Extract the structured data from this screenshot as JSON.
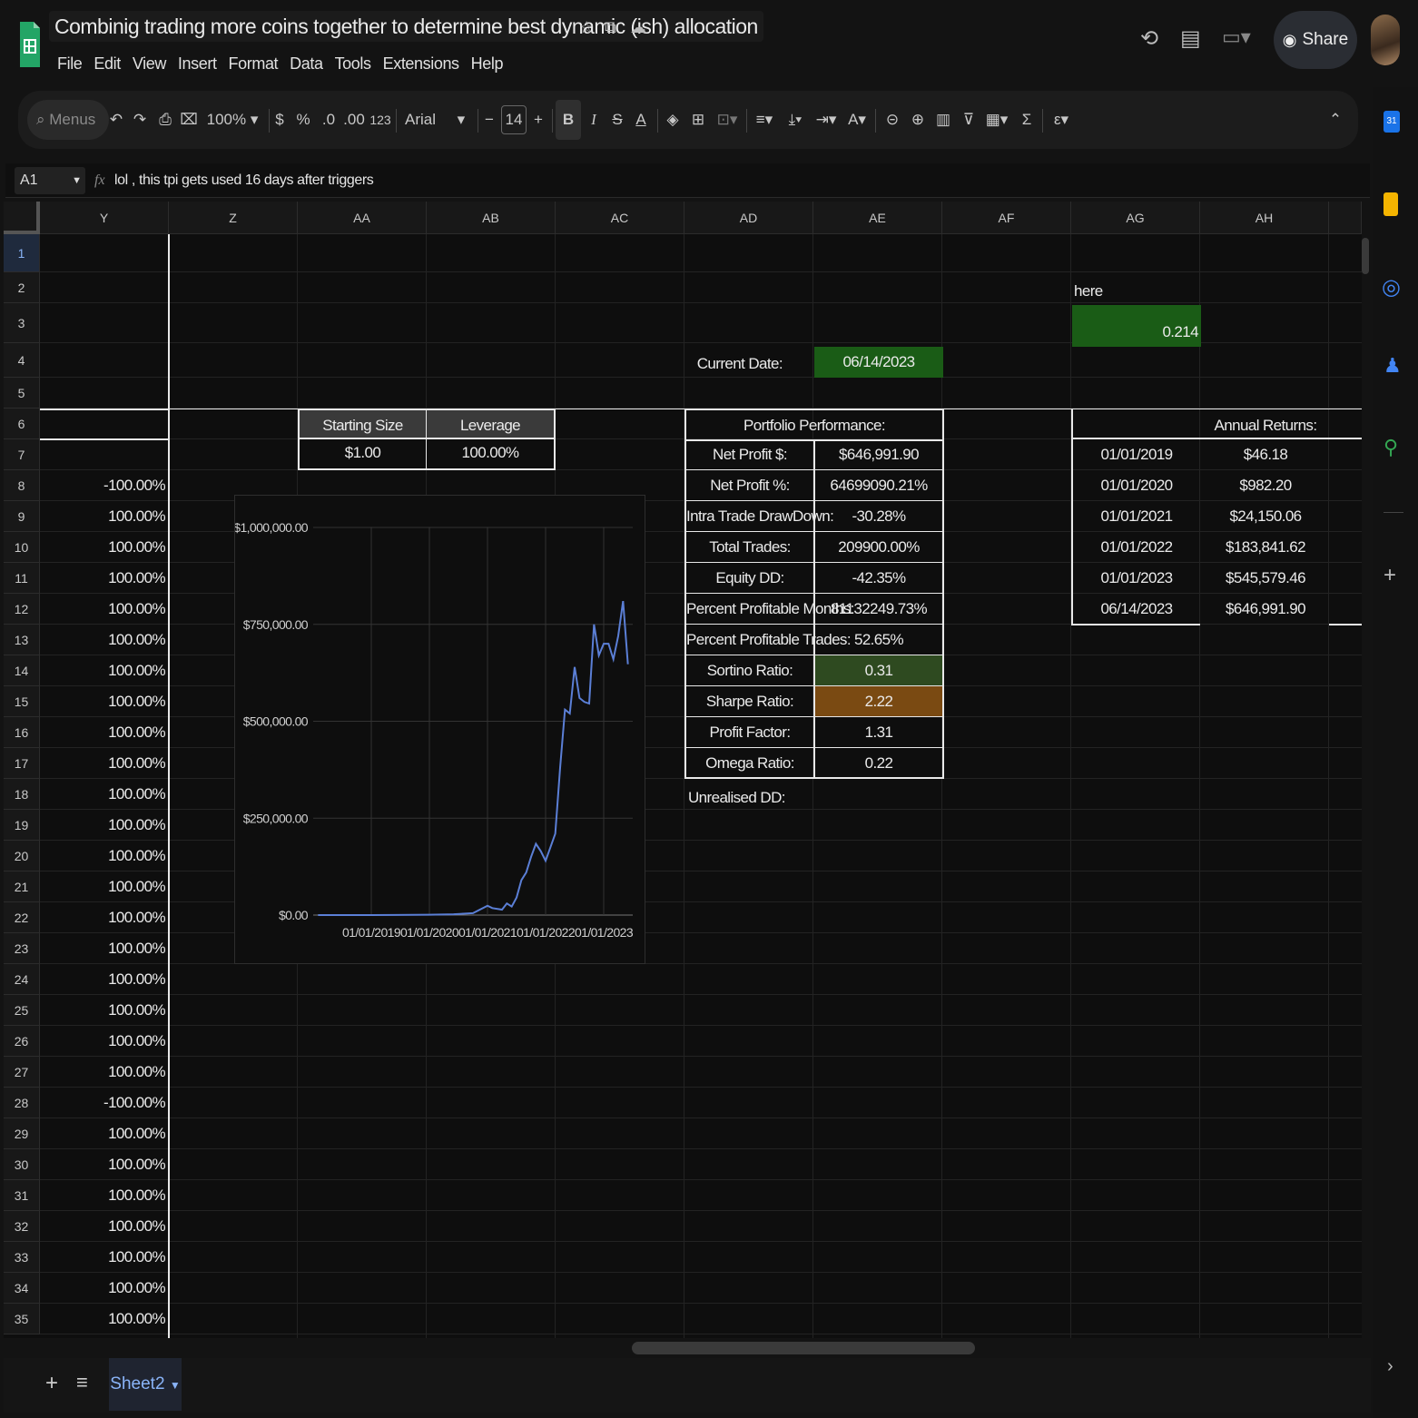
{
  "app": {
    "title": "Combinig trading more coins together to determine best dynamic (ish) allocation",
    "menus": [
      "File",
      "Edit",
      "View",
      "Insert",
      "Format",
      "Data",
      "Tools",
      "Extensions",
      "Help"
    ],
    "share_label": "Share"
  },
  "toolbar": {
    "search_placeholder": "Menus",
    "zoom": "100%",
    "currency": "$",
    "percent": "%",
    "dec_decrease": ".0",
    "dec_increase": ".00",
    "number_format": "123",
    "font": "Arial",
    "font_size": "14",
    "bold": "B",
    "italic": "I"
  },
  "formula_bar": {
    "cell_ref": "A1",
    "fx": "fx",
    "content": "lol , this tpi gets used 16 days after triggers"
  },
  "columns": [
    "Y",
    "Z",
    "AA",
    "AB",
    "AC",
    "AD",
    "AE",
    "AF",
    "AG",
    "AH"
  ],
  "rows": [
    "1",
    "2",
    "3",
    "4",
    "5",
    "6",
    "7",
    "8",
    "9",
    "10",
    "11",
    "12",
    "13",
    "14",
    "15",
    "16",
    "17",
    "18",
    "19",
    "20",
    "21",
    "22",
    "23",
    "24",
    "25",
    "26",
    "27",
    "28",
    "29",
    "30",
    "31",
    "32",
    "33",
    "34",
    "35"
  ],
  "col_y": [
    "-100.00%",
    "100.00%",
    "100.00%",
    "100.00%",
    "100.00%",
    "100.00%",
    "100.00%",
    "100.00%",
    "100.00%",
    "100.00%",
    "100.00%",
    "100.00%",
    "100.00%",
    "100.00%",
    "100.00%",
    "100.00%",
    "100.00%",
    "100.00%",
    "100.00%",
    "100.00%",
    "-100.00%",
    "100.00%",
    "100.00%",
    "100.00%",
    "100.00%",
    "100.00%",
    "100.00%",
    "100.00%"
  ],
  "here_label": "here",
  "here_value": "0.214",
  "current_date_label": "Current Date:",
  "current_date": "06/14/2023",
  "inputs": {
    "starting_size_label": "Starting Size",
    "leverage_label": "Leverage",
    "starting_size": "$1.00",
    "leverage": "100.00%"
  },
  "portfolio": {
    "header": "Portfolio Performance:",
    "rows": [
      {
        "label": "Net Profit $:",
        "value": "$646,991.90"
      },
      {
        "label": "Net Profit %:",
        "value": "64699090.21%"
      },
      {
        "label": "Intra Trade DrawDown:",
        "value": "-30.28%"
      },
      {
        "label": "Total Trades:",
        "value": "209900.00%"
      },
      {
        "label": "Equity DD:",
        "value": "-42.35%"
      },
      {
        "label": "Percent Profitable Months:",
        "value": "81132249.73%"
      },
      {
        "label": "Percent Profitable Trades:",
        "value": "52.65%"
      },
      {
        "label": "Sortino Ratio:",
        "value": "0.31"
      },
      {
        "label": "Sharpe Ratio:",
        "value": "2.22"
      },
      {
        "label": "Profit Factor:",
        "value": "1.31"
      },
      {
        "label": "Omega Ratio:",
        "value": "0.22"
      }
    ],
    "unrealised": "Unrealised DD:"
  },
  "annual": {
    "header": "Annual Returns:",
    "rows": [
      {
        "date": "01/01/2019",
        "value": "$46.18"
      },
      {
        "date": "01/01/2020",
        "value": "$982.20"
      },
      {
        "date": "01/01/2021",
        "value": "$24,150.06"
      },
      {
        "date": "01/01/2022",
        "value": "$183,841.62"
      },
      {
        "date": "01/01/2023",
        "value": "$545,579.46"
      },
      {
        "date": "06/14/2023",
        "value": "$646,991.90"
      }
    ]
  },
  "colors": {
    "green_cell": "#1a5c16",
    "sortino_bg": "#2e4a20",
    "sharpe_bg": "#7a4a12",
    "line": "#5b7fd6"
  },
  "sheet_tab": "Sheet2",
  "chart_data": {
    "type": "line",
    "title": "",
    "xlabel": "",
    "ylabel": "",
    "ylim": [
      0,
      1000000
    ],
    "y_ticks": [
      "$0.00",
      "$250,000.00",
      "$500,000.00",
      "$750,000.00",
      "$1,000,000.00"
    ],
    "x_ticks": [
      "01/01/2019",
      "01/01/2020",
      "01/01/2021",
      "01/01/2022",
      "01/01/2023"
    ],
    "series": [
      {
        "x": [
          "2018-02",
          "2018-06",
          "2018-10",
          "2019-01",
          "2019-06",
          "2020-01",
          "2020-06",
          "2020-10",
          "2021-01",
          "2021-02",
          "2021-04",
          "2021-05",
          "2021-06",
          "2021-07",
          "2021-08",
          "2021-09",
          "2021-10",
          "2021-11",
          "2021-12",
          "2022-01",
          "2022-02",
          "2022-03",
          "2022-04",
          "2022-05",
          "2022-06",
          "2022-07",
          "2022-08",
          "2022-09",
          "2022-10",
          "2022-11",
          "2022-12",
          "2023-01",
          "2023-02",
          "2023-03",
          "2023-04",
          "2023-05",
          "2023-06"
        ],
        "values": [
          0,
          0,
          0,
          46,
          200,
          982,
          2000,
          5000,
          24150,
          18000,
          14000,
          30000,
          22000,
          45000,
          90000,
          110000,
          150000,
          183841,
          165000,
          140000,
          175000,
          210000,
          380000,
          530000,
          520000,
          640000,
          560000,
          550000,
          545579,
          750000,
          670000,
          700000,
          700000,
          660000,
          720000,
          810000,
          646991
        ]
      }
    ]
  }
}
